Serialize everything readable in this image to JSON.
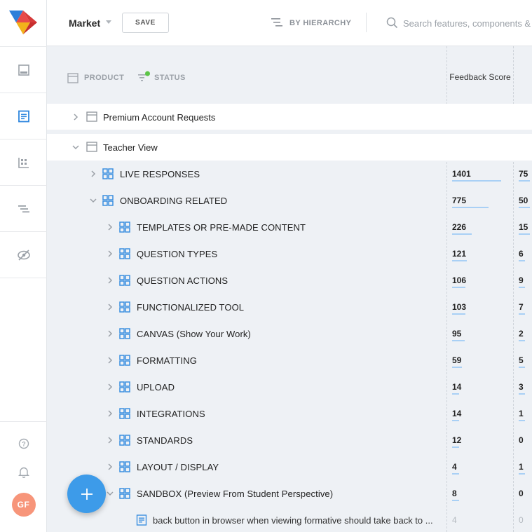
{
  "header": {
    "workspace": "Market",
    "save_label": "SAVE",
    "hierarchy_label": "BY HIERARCHY",
    "search_placeholder": "Search features, components & notes"
  },
  "sidebar": {
    "items": [
      "inbox-icon",
      "notes-icon",
      "board-icon",
      "roadmap-icon",
      "hidden-icon"
    ],
    "active_index": 1,
    "avatar_initials": "GF"
  },
  "columns": {
    "product": "PRODUCT",
    "status": "STATUS",
    "feedback": "Feedback Score"
  },
  "rows": [
    {
      "label": "Premium Account Requests",
      "type": "product",
      "expanded": false
    },
    {
      "label": "Teacher View",
      "type": "product",
      "expanded": true
    },
    {
      "label": "LIVE RESPONSES",
      "type": "component",
      "expanded": false,
      "v1": "1401",
      "v2": "75"
    },
    {
      "label": "ONBOARDING RELATED",
      "type": "component",
      "expanded": true,
      "v1": "775",
      "v2": "50"
    },
    {
      "label": "TEMPLATES OR PRE-MADE CONTENT",
      "type": "component",
      "expanded": false,
      "v1": "226",
      "v2": "15"
    },
    {
      "label": "QUESTION TYPES",
      "type": "component",
      "expanded": false,
      "v1": "121",
      "v2": "6"
    },
    {
      "label": "QUESTION ACTIONS",
      "type": "component",
      "expanded": false,
      "v1": "106",
      "v2": "9"
    },
    {
      "label": "FUNCTIONALIZED TOOL",
      "type": "component",
      "expanded": false,
      "v1": "103",
      "v2": "7"
    },
    {
      "label": "CANVAS (Show Your Work)",
      "type": "component",
      "expanded": false,
      "v1": "95",
      "v2": "2"
    },
    {
      "label": "FORMATTING",
      "type": "component",
      "expanded": false,
      "v1": "59",
      "v2": "5"
    },
    {
      "label": "UPLOAD",
      "type": "component",
      "expanded": false,
      "v1": "14",
      "v2": "3"
    },
    {
      "label": "INTEGRATIONS",
      "type": "component",
      "expanded": false,
      "v1": "14",
      "v2": "1"
    },
    {
      "label": "STANDARDS",
      "type": "component",
      "expanded": false,
      "v1": "12",
      "v2": "0"
    },
    {
      "label": "LAYOUT / DISPLAY",
      "type": "component",
      "expanded": false,
      "v1": "4",
      "v2": "1"
    },
    {
      "label": "SANDBOX (Preview From Student Perspective)",
      "type": "component",
      "expanded": true,
      "v1": "8",
      "v2": "0"
    },
    {
      "label": "back button in browser when viewing formative should take back to ...",
      "type": "feature",
      "v1": "4",
      "v2": "0"
    }
  ],
  "colors": {
    "accent": "#3d9be9",
    "component_icon": "#3b8fe0",
    "bar": "#a9d0f5",
    "status_dot": "#5cc547",
    "avatar": "#f7957a"
  }
}
